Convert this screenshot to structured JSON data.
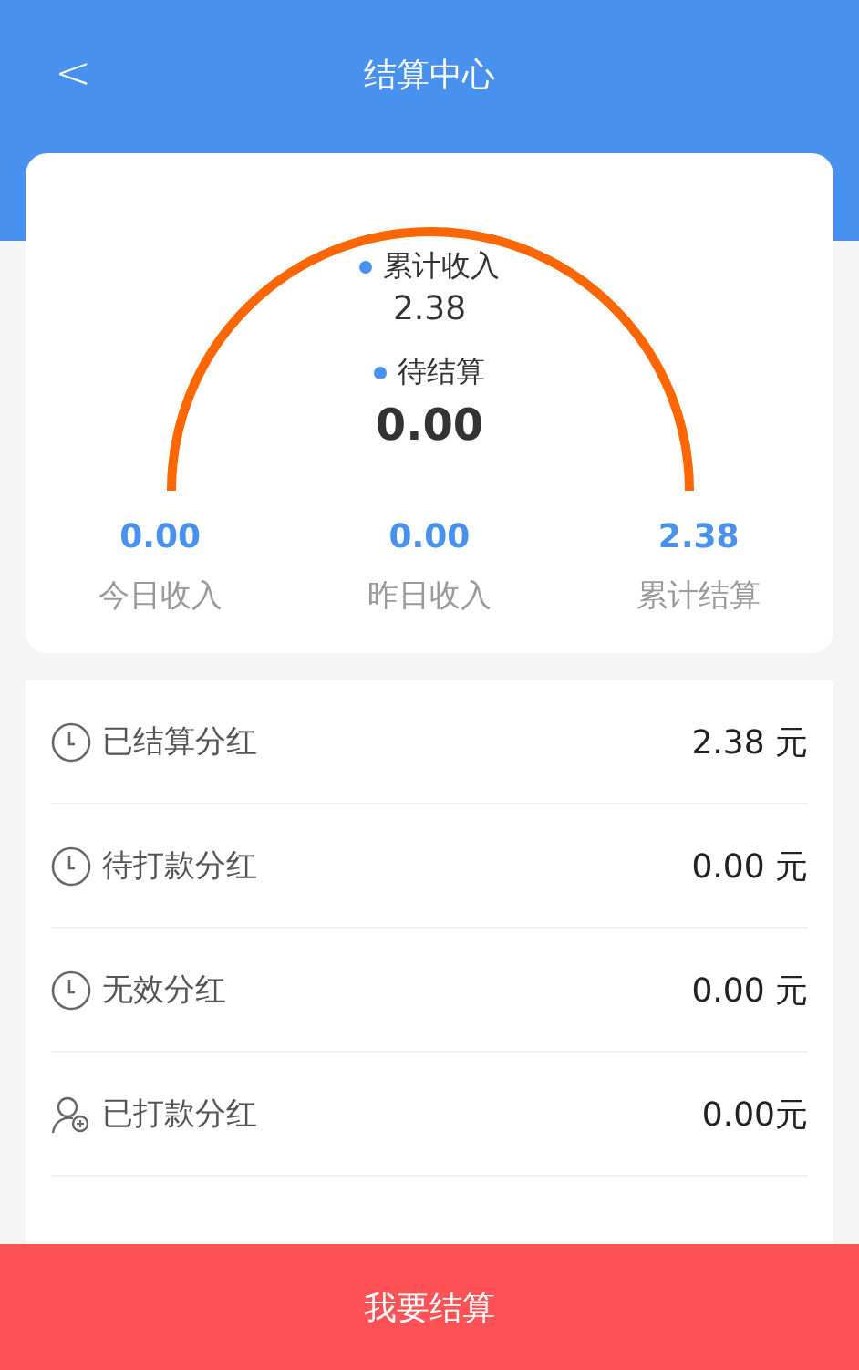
{
  "header": {
    "back": "<",
    "title": "结算中心"
  },
  "gauge": {
    "items": [
      {
        "label": "累计收入",
        "value": "2.38",
        "emphasis": false
      },
      {
        "label": "待结算",
        "value": "0.00",
        "emphasis": true
      }
    ]
  },
  "stats": [
    {
      "value": "0.00",
      "label": "今日收入"
    },
    {
      "value": "0.00",
      "label": "昨日收入"
    },
    {
      "value": "2.38",
      "label": "累计结算"
    }
  ],
  "rows": [
    {
      "kind": "clock",
      "label": "已结算分红",
      "amount": "2.38 元"
    },
    {
      "kind": "clock",
      "label": "待打款分红",
      "amount": "0.00 元"
    },
    {
      "kind": "clock",
      "label": "无效分红",
      "amount": "0.00 元"
    },
    {
      "kind": "user",
      "label": "已打款分红",
      "amount": "0.00元"
    }
  ],
  "action_button": "我要结算"
}
